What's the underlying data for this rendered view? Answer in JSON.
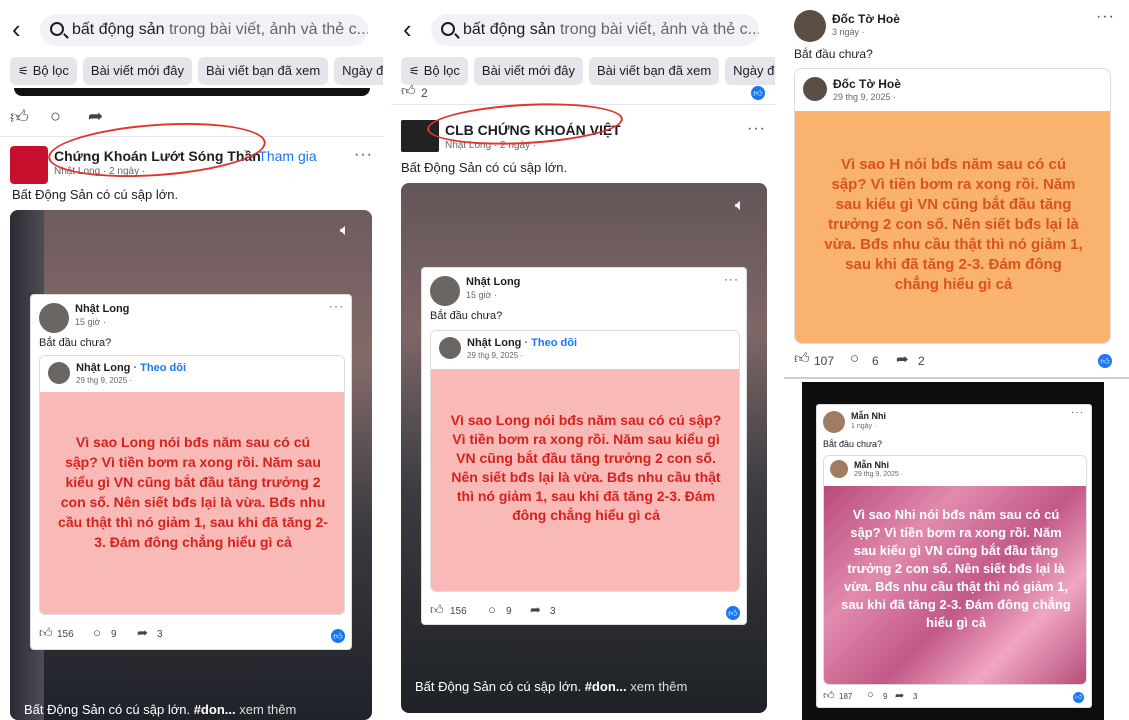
{
  "search": {
    "query": "bất động sản",
    "placeholder_rest": " trong bài viết, ảnh và thẻ c..."
  },
  "chips": [
    "Bộ lọc",
    "Bài viết mới đây",
    "Bài viết bạn đã xem",
    "Ngày đ"
  ],
  "panel1": {
    "page_name": "Chứng Khoán Lướt Sóng Thần",
    "join_label": "· Tham gia",
    "author": "Nhật Long",
    "time": "· 2 ngày ·",
    "caption": "Bất Động Sản có cú sập lớn.",
    "inner_post": {
      "author": "Nhật Long",
      "time": "15 giờ ·",
      "text": "Bắt đầu chưa?",
      "shared_author": "Nhật Long",
      "follow_label": "· Theo dõi",
      "shared_time": "29 thg 9, 2025 ·",
      "quote": "Vì sao Long nói bđs năm sau có cú sập? Vì tiền bơm ra xong rồi. Năm sau kiểu gì VN cũng bắt đầu tăng trưởng 2 con số. Nên siết bđs lại là vừa. Bđs nhu cầu thật thì nó giảm 1, sau khi đã tăng 2-3. Đám đông chẳng hiểu gì cả",
      "likes": "156",
      "comments": "9",
      "shares": "3"
    },
    "video_caption": "Bất Động Sản có cú sập lớn.",
    "hashtag": "#don...",
    "see_more": "xem thêm"
  },
  "panel2": {
    "top_count": "2",
    "page_name": "CLB CHỨNG KHOÁN VIỆT",
    "author": "Nhật Long",
    "time": "· 2 ngày ·",
    "caption": "Bất Động Sản có cú sập lớn.",
    "inner_post": {
      "author": "Nhật Long",
      "time": "15 giờ ·",
      "text": "Bắt đầu chưa?",
      "shared_author": "Nhật Long",
      "follow_label": "· Theo dõi",
      "shared_time": "29 thg 9, 2025 ·",
      "quote": "Vì sao Long nói bđs năm sau có cú sập? Vì tiền bơm ra xong rồi. Năm sau kiểu gì VN cũng bắt đầu tăng trưởng 2 con số. Nên siết bđs lại là vừa. Bđs nhu cầu thật thì nó giảm 1, sau khi đã tăng 2-3. Đám đông chẳng hiểu gì cả",
      "likes": "156",
      "comments": "9",
      "shares": "3"
    },
    "video_caption": "Bất Động Sản có cú sập lớn.",
    "hashtag": "#don...",
    "see_more": "xem thêm"
  },
  "panel3": {
    "author": "Đốc Tờ Hoè",
    "time": "3 ngày ·",
    "text": "Bắt đầu chưa?",
    "shared_author": "Đốc Tờ Hoè",
    "shared_time": "29 thg 9, 2025 ·",
    "quote": "Vì sao H nói bđs năm sau có cú sập? Vì tiền bơm ra xong rồi. Năm sau kiểu gì VN cũng bắt đầu tăng trưởng 2 con số. Nên siết bđs lại là vừa. Bđs nhu cầu thật thì nó giảm 1, sau khi đã tăng 2-3. Đám đông chẳng hiểu gì cả",
    "likes": "107",
    "comments": "6",
    "shares": "2",
    "post2": {
      "author": "Mẫn Nhi",
      "time": "1 ngày ·",
      "text": "Bắt đầu chưa?",
      "shared_author": "Mẫn Nhi",
      "shared_time": "29 thg 9, 2025 ·",
      "quote": "Vì sao Nhi nói bđs năm sau có cú sập? Vì tiền bơm ra xong rồi. Năm sau kiểu gì VN cũng bắt đầu tăng trưởng 2 con số. Nên siết bđs lại là vừa. Bđs nhu cầu thật thì nó giảm 1, sau khi đã tăng 2-3. Đám đông chẳng hiểu gì cả",
      "likes": "187",
      "comments": "9",
      "shares": "3"
    }
  }
}
